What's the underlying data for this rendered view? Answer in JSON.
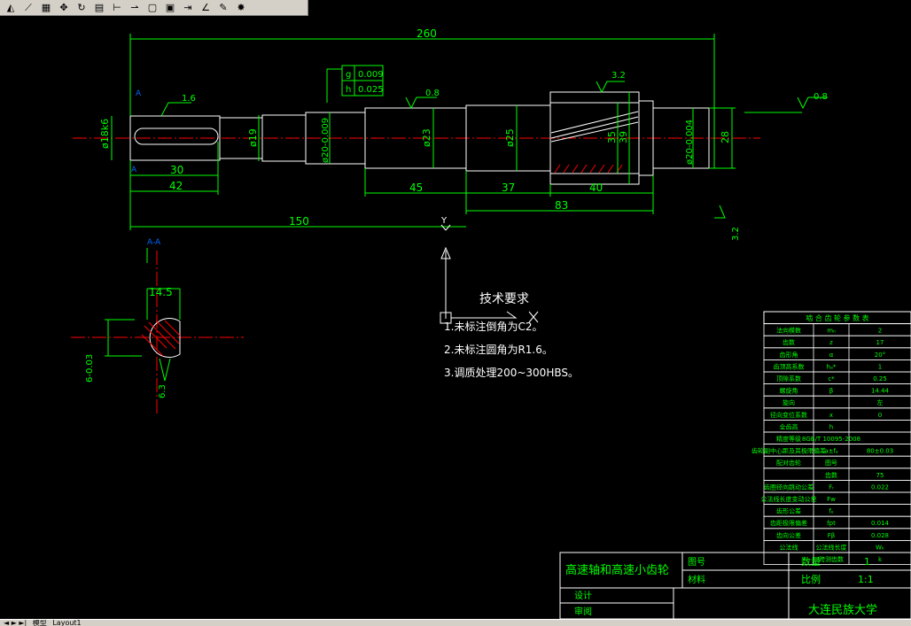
{
  "toolbar": {
    "buttons": [
      {
        "name": "linear-dim-icon",
        "glyph": "◭"
      },
      {
        "name": "aligned-dim-icon",
        "glyph": "⟋"
      },
      {
        "name": "grid-icon",
        "glyph": "▦"
      },
      {
        "name": "pan-icon",
        "glyph": "✥"
      },
      {
        "name": "rotate-icon",
        "glyph": "↻"
      },
      {
        "name": "dim-style-icon",
        "glyph": "▤"
      },
      {
        "name": "baseline-icon",
        "glyph": "⊢"
      },
      {
        "name": "leader-icon",
        "glyph": "⇀"
      },
      {
        "name": "box-icon",
        "glyph": "▢"
      },
      {
        "name": "box-edit-icon",
        "glyph": "▣"
      },
      {
        "name": "continue-icon",
        "glyph": "⇥"
      },
      {
        "name": "angle-icon",
        "glyph": "∠"
      },
      {
        "name": "edit-icon",
        "glyph": "✎"
      },
      {
        "name": "paint-icon",
        "glyph": "✸"
      }
    ]
  },
  "drawing": {
    "dims": {
      "overall": "260",
      "d18": "ø18k6",
      "d19": "ø19",
      "d20a": "ø20-0.009",
      "d23": "ø23",
      "d25": "ø25",
      "d35": "35",
      "d39": "39",
      "d20b": "ø20-0.004",
      "d28": "28",
      "l30": "30",
      "l42": "42",
      "l45": "45",
      "l37": "37",
      "l40": "40",
      "l83": "83",
      "l150": "150",
      "tol_g": "g",
      "tol_g_val": "0.009",
      "tol_h": "h",
      "tol_h_val": "0.025",
      "rough16": "1.6",
      "rough08a": "0.8",
      "rough32a": "3.2",
      "rough08b": "0.8",
      "rough32b": "3.2",
      "section_mark": "A",
      "section_title": "A-A",
      "sec_145": "14.5",
      "sec_tol": "6-0.03",
      "sec_rough": "6.3",
      "cursor_label": "Y"
    },
    "tech": {
      "title": "技术要求",
      "lines": [
        "1.未标注倒角为C2。",
        "2.未标注圆角为R1.6。",
        "3.调质处理200~300HBS。"
      ]
    },
    "params": {
      "header": "啮 合 齿 轮 参 数 表",
      "rows": [
        [
          "法向模数",
          "mₙ",
          "2"
        ],
        [
          "齿数",
          "z",
          "17"
        ],
        [
          "齿形角",
          "α",
          "20°"
        ],
        [
          "齿顶高系数",
          "hₐ*",
          "1"
        ],
        [
          "顶隙系数",
          "c*",
          "0.25"
        ],
        [
          "螺旋角",
          "β",
          "14.44"
        ],
        [
          "旋向",
          "",
          "左"
        ],
        [
          "径向变位系数",
          "x",
          "0"
        ],
        [
          "全齿高",
          "h",
          ""
        ],
        [
          "精度等级",
          "8GB/T 10095-2008",
          ""
        ],
        [
          "齿轮副中心距及其极限偏差",
          "a±fₐ",
          "80±0.03"
        ],
        [
          "配对齿轮",
          "图号",
          ""
        ],
        [
          "",
          "齿数",
          "75"
        ],
        [
          "齿圈径向跳动公差",
          "Fᵣ",
          "0.022"
        ],
        [
          "公法线长度变动公差",
          "Fw",
          ""
        ],
        [
          "齿形公差",
          "fₑ",
          ""
        ],
        [
          "齿距极限偏差",
          "fpt",
          "0.014"
        ],
        [
          "齿向公差",
          "Fβ",
          "0.028"
        ],
        [
          "公法线",
          "公法线长度",
          "Wₖ"
        ],
        [
          "",
          "跨测齿数",
          "k"
        ]
      ]
    },
    "titleblock": {
      "name": "高速轴和高速小齿轮",
      "drawing_no_label": "图号",
      "material_label": "材料",
      "qty_label": "数量",
      "qty_value": "1",
      "scale_label": "比例",
      "scale_value": "1:1",
      "design_label": "设计",
      "review_label": "审阅",
      "school": "大连民族大学"
    }
  },
  "tabs": {
    "nav": "◄ ► ►|",
    "model": "模型",
    "layout": "Layout1"
  },
  "colors": {
    "green": "#00ff00",
    "red": "#ff0000",
    "white": "#ffffff",
    "background": "#000000"
  }
}
